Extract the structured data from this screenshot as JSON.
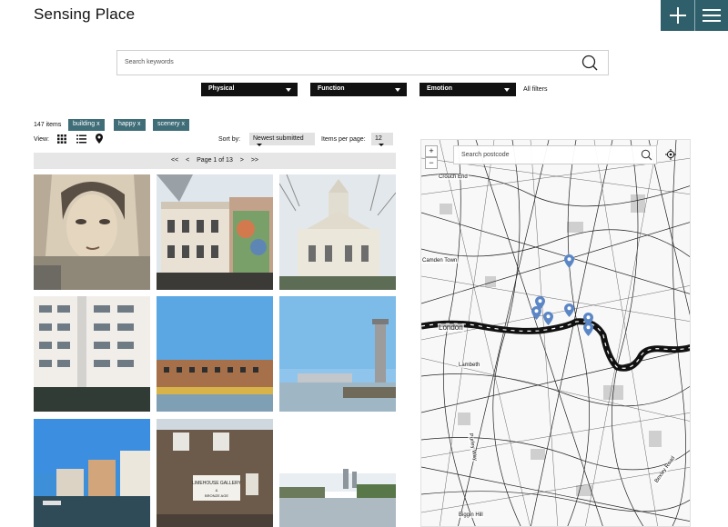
{
  "header": {
    "logo": "Sensing Place",
    "add_icon": "plus-icon",
    "menu_icon": "hamburger-icon",
    "accent": "#2f5f6a"
  },
  "search": {
    "placeholder": "Search keywords",
    "icon": "search-icon"
  },
  "filters": [
    {
      "label": "Physical"
    },
    {
      "label": "Function"
    },
    {
      "label": "Emotion"
    }
  ],
  "all_filters": "All filters",
  "results": {
    "count": "147 items",
    "tags": [
      "building x",
      "happy x",
      "scenery x"
    ]
  },
  "view": {
    "label": "View:",
    "icons": [
      "grid-icon",
      "list-icon",
      "map-pin-icon"
    ]
  },
  "sort": {
    "label": "Sort by:",
    "value": "Newest submitted"
  },
  "per_page": {
    "label": "Items per page:",
    "value": "12"
  },
  "pager": {
    "first": "<<",
    "prev": "<",
    "page": "Page 1 of 13",
    "next": ">",
    "last": ">>"
  },
  "photos": [
    {
      "subject": "mural of a woman's face"
    },
    {
      "subject": "building with painted mural"
    },
    {
      "subject": "white church tower"
    },
    {
      "subject": "modern white office block"
    },
    {
      "subject": "brick warehouse by water"
    },
    {
      "subject": "river with tower crane"
    },
    {
      "subject": "marina with apartments"
    },
    {
      "subject": "Limehouse Gallery sign",
      "sign_text": "LIMEHOUSE GALLERY & BRONZE AGE"
    },
    {
      "subject": "river view with city skyline"
    }
  ],
  "map": {
    "search_placeholder": "Search postcode",
    "zoom_in": "+",
    "zoom_out": "−",
    "places": [
      "Crouch End",
      "Camden Town",
      "London",
      "Lambeth",
      "Biggin Hill",
      "Bexley Road",
      "Purley Way"
    ],
    "marker_color": "#5b86c5"
  }
}
